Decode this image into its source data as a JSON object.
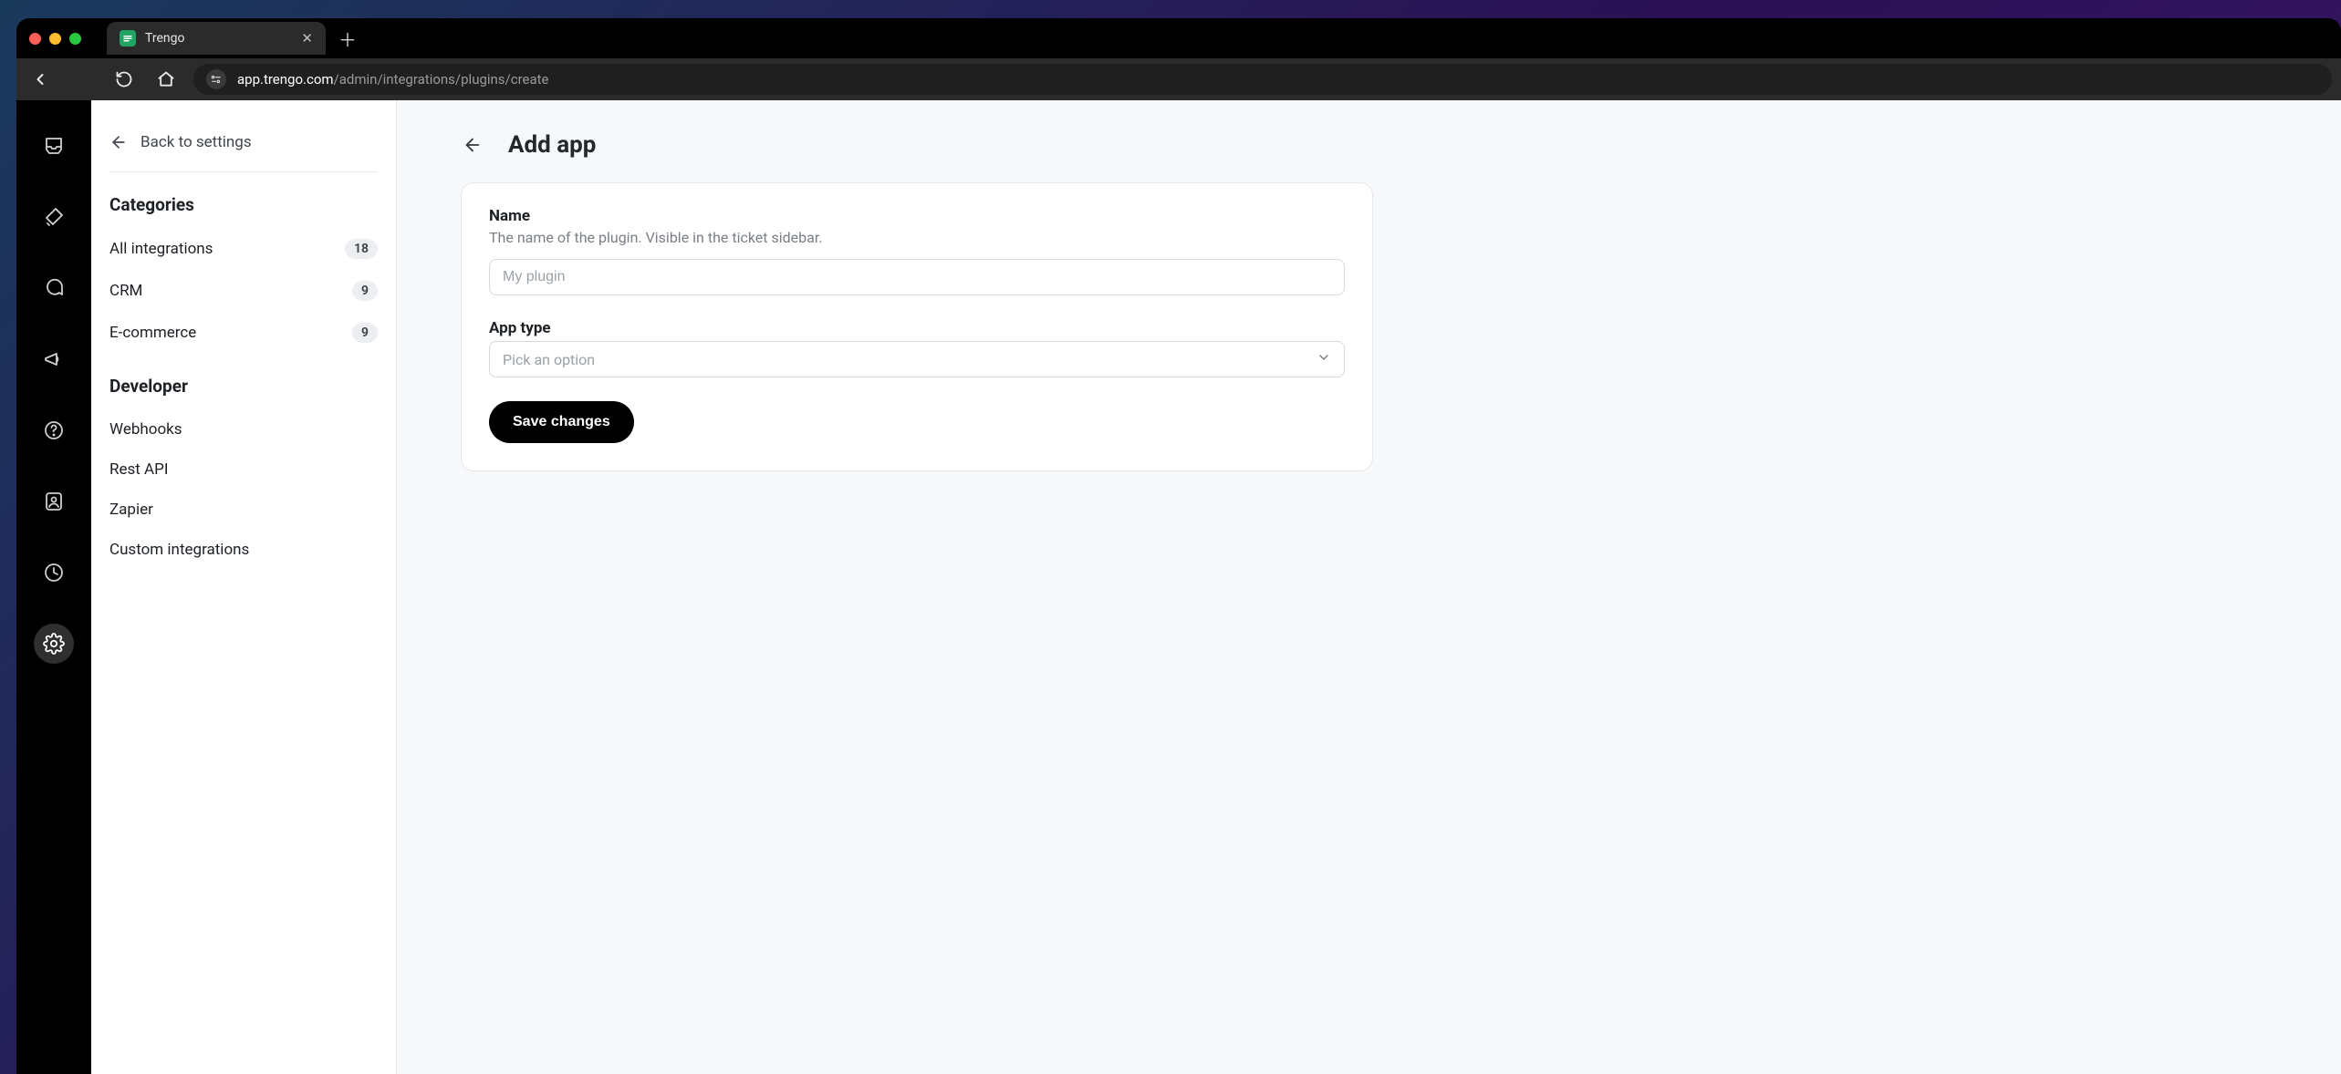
{
  "browser": {
    "tab_title": "Trengo",
    "url_host": "app.trengo.com",
    "url_path": "/admin/integrations/plugins/create"
  },
  "sidebar": {
    "back_label": "Back to settings",
    "categories_title": "Categories",
    "categories": [
      {
        "label": "All integrations",
        "count": "18"
      },
      {
        "label": "CRM",
        "count": "9"
      },
      {
        "label": "E-commerce",
        "count": "9"
      }
    ],
    "developer_title": "Developer",
    "developer_items": [
      {
        "label": "Webhooks"
      },
      {
        "label": "Rest API"
      },
      {
        "label": "Zapier"
      },
      {
        "label": "Custom integrations"
      }
    ]
  },
  "page": {
    "title": "Add app",
    "name_label": "Name",
    "name_help": "The name of the plugin. Visible in the ticket sidebar.",
    "name_placeholder": "My plugin",
    "type_label": "App type",
    "type_placeholder": "Pick an option",
    "save_label": "Save changes"
  }
}
